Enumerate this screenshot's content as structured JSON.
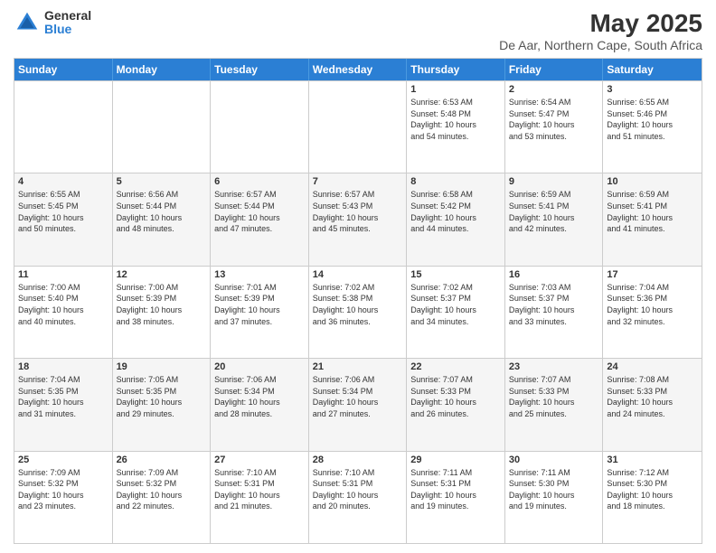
{
  "logo": {
    "general": "General",
    "blue": "Blue"
  },
  "title": "May 2025",
  "location": "De Aar, Northern Cape, South Africa",
  "header_days": [
    "Sunday",
    "Monday",
    "Tuesday",
    "Wednesday",
    "Thursday",
    "Friday",
    "Saturday"
  ],
  "rows": [
    [
      {
        "day": "",
        "lines": [],
        "empty": true
      },
      {
        "day": "",
        "lines": [],
        "empty": true
      },
      {
        "day": "",
        "lines": [],
        "empty": true
      },
      {
        "day": "",
        "lines": [],
        "empty": true
      },
      {
        "day": "1",
        "lines": [
          "Sunrise: 6:53 AM",
          "Sunset: 5:48 PM",
          "Daylight: 10 hours",
          "and 54 minutes."
        ]
      },
      {
        "day": "2",
        "lines": [
          "Sunrise: 6:54 AM",
          "Sunset: 5:47 PM",
          "Daylight: 10 hours",
          "and 53 minutes."
        ]
      },
      {
        "day": "3",
        "lines": [
          "Sunrise: 6:55 AM",
          "Sunset: 5:46 PM",
          "Daylight: 10 hours",
          "and 51 minutes."
        ]
      }
    ],
    [
      {
        "day": "4",
        "lines": [
          "Sunrise: 6:55 AM",
          "Sunset: 5:45 PM",
          "Daylight: 10 hours",
          "and 50 minutes."
        ]
      },
      {
        "day": "5",
        "lines": [
          "Sunrise: 6:56 AM",
          "Sunset: 5:44 PM",
          "Daylight: 10 hours",
          "and 48 minutes."
        ]
      },
      {
        "day": "6",
        "lines": [
          "Sunrise: 6:57 AM",
          "Sunset: 5:44 PM",
          "Daylight: 10 hours",
          "and 47 minutes."
        ]
      },
      {
        "day": "7",
        "lines": [
          "Sunrise: 6:57 AM",
          "Sunset: 5:43 PM",
          "Daylight: 10 hours",
          "and 45 minutes."
        ]
      },
      {
        "day": "8",
        "lines": [
          "Sunrise: 6:58 AM",
          "Sunset: 5:42 PM",
          "Daylight: 10 hours",
          "and 44 minutes."
        ]
      },
      {
        "day": "9",
        "lines": [
          "Sunrise: 6:59 AM",
          "Sunset: 5:41 PM",
          "Daylight: 10 hours",
          "and 42 minutes."
        ]
      },
      {
        "day": "10",
        "lines": [
          "Sunrise: 6:59 AM",
          "Sunset: 5:41 PM",
          "Daylight: 10 hours",
          "and 41 minutes."
        ]
      }
    ],
    [
      {
        "day": "11",
        "lines": [
          "Sunrise: 7:00 AM",
          "Sunset: 5:40 PM",
          "Daylight: 10 hours",
          "and 40 minutes."
        ]
      },
      {
        "day": "12",
        "lines": [
          "Sunrise: 7:00 AM",
          "Sunset: 5:39 PM",
          "Daylight: 10 hours",
          "and 38 minutes."
        ]
      },
      {
        "day": "13",
        "lines": [
          "Sunrise: 7:01 AM",
          "Sunset: 5:39 PM",
          "Daylight: 10 hours",
          "and 37 minutes."
        ]
      },
      {
        "day": "14",
        "lines": [
          "Sunrise: 7:02 AM",
          "Sunset: 5:38 PM",
          "Daylight: 10 hours",
          "and 36 minutes."
        ]
      },
      {
        "day": "15",
        "lines": [
          "Sunrise: 7:02 AM",
          "Sunset: 5:37 PM",
          "Daylight: 10 hours",
          "and 34 minutes."
        ]
      },
      {
        "day": "16",
        "lines": [
          "Sunrise: 7:03 AM",
          "Sunset: 5:37 PM",
          "Daylight: 10 hours",
          "and 33 minutes."
        ]
      },
      {
        "day": "17",
        "lines": [
          "Sunrise: 7:04 AM",
          "Sunset: 5:36 PM",
          "Daylight: 10 hours",
          "and 32 minutes."
        ]
      }
    ],
    [
      {
        "day": "18",
        "lines": [
          "Sunrise: 7:04 AM",
          "Sunset: 5:35 PM",
          "Daylight: 10 hours",
          "and 31 minutes."
        ]
      },
      {
        "day": "19",
        "lines": [
          "Sunrise: 7:05 AM",
          "Sunset: 5:35 PM",
          "Daylight: 10 hours",
          "and 29 minutes."
        ]
      },
      {
        "day": "20",
        "lines": [
          "Sunrise: 7:06 AM",
          "Sunset: 5:34 PM",
          "Daylight: 10 hours",
          "and 28 minutes."
        ]
      },
      {
        "day": "21",
        "lines": [
          "Sunrise: 7:06 AM",
          "Sunset: 5:34 PM",
          "Daylight: 10 hours",
          "and 27 minutes."
        ]
      },
      {
        "day": "22",
        "lines": [
          "Sunrise: 7:07 AM",
          "Sunset: 5:33 PM",
          "Daylight: 10 hours",
          "and 26 minutes."
        ]
      },
      {
        "day": "23",
        "lines": [
          "Sunrise: 7:07 AM",
          "Sunset: 5:33 PM",
          "Daylight: 10 hours",
          "and 25 minutes."
        ]
      },
      {
        "day": "24",
        "lines": [
          "Sunrise: 7:08 AM",
          "Sunset: 5:33 PM",
          "Daylight: 10 hours",
          "and 24 minutes."
        ]
      }
    ],
    [
      {
        "day": "25",
        "lines": [
          "Sunrise: 7:09 AM",
          "Sunset: 5:32 PM",
          "Daylight: 10 hours",
          "and 23 minutes."
        ]
      },
      {
        "day": "26",
        "lines": [
          "Sunrise: 7:09 AM",
          "Sunset: 5:32 PM",
          "Daylight: 10 hours",
          "and 22 minutes."
        ]
      },
      {
        "day": "27",
        "lines": [
          "Sunrise: 7:10 AM",
          "Sunset: 5:31 PM",
          "Daylight: 10 hours",
          "and 21 minutes."
        ]
      },
      {
        "day": "28",
        "lines": [
          "Sunrise: 7:10 AM",
          "Sunset: 5:31 PM",
          "Daylight: 10 hours",
          "and 20 minutes."
        ]
      },
      {
        "day": "29",
        "lines": [
          "Sunrise: 7:11 AM",
          "Sunset: 5:31 PM",
          "Daylight: 10 hours",
          "and 19 minutes."
        ]
      },
      {
        "day": "30",
        "lines": [
          "Sunrise: 7:11 AM",
          "Sunset: 5:30 PM",
          "Daylight: 10 hours",
          "and 19 minutes."
        ]
      },
      {
        "day": "31",
        "lines": [
          "Sunrise: 7:12 AM",
          "Sunset: 5:30 PM",
          "Daylight: 10 hours",
          "and 18 minutes."
        ]
      }
    ]
  ]
}
